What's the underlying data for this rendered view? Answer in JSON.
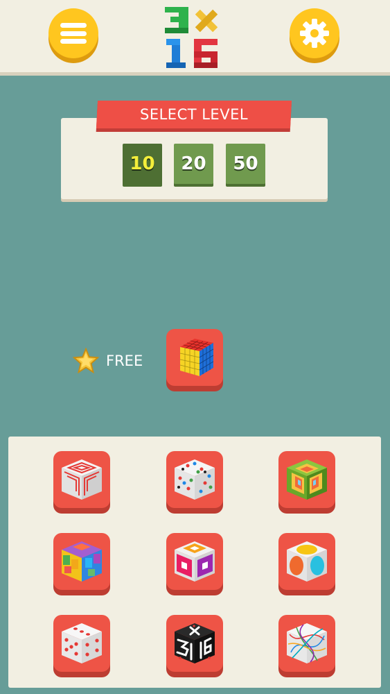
{
  "colors": {
    "background": "#679d98",
    "panel": "#f2efe2",
    "accent_red": "#ee4f46",
    "accent_yellow": "#ffc61f",
    "level_green": "#709a4e"
  },
  "header": {
    "menu_icon": "hamburger-menu-icon",
    "settings_icon": "gear-icon",
    "logo_glyphs": [
      "3",
      "x",
      "1",
      "6"
    ]
  },
  "level_select": {
    "title": "SELECT LEVEL",
    "options": [
      "10",
      "20",
      "50"
    ],
    "selected": "10"
  },
  "featured": {
    "badge_icon": "star-icon",
    "label": "FREE",
    "cube": "numbered-rubiks-cube"
  },
  "puzzles": [
    "white-spiral-cube",
    "dotted-white-cube",
    "layered-rings-cube",
    "colored-blocks-cube",
    "square-pattern-cube",
    "circle-pattern-cube",
    "dice-cube",
    "number-3x16-cube",
    "tangled-lines-cube"
  ]
}
